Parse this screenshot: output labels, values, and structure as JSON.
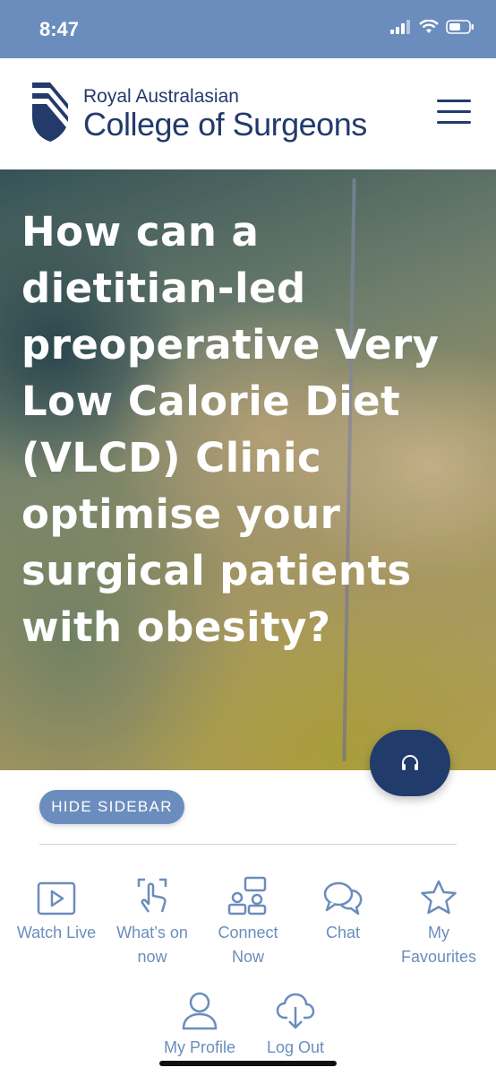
{
  "status_bar": {
    "time": "8:47"
  },
  "header": {
    "brand_line1": "Royal Australasian",
    "brand_line2": "College of Surgeons"
  },
  "hero": {
    "title": "How can a dietitian-led preoperative Very Low Calorie Diet (VLCD) Clinic optimise your surgical patients with obesity?"
  },
  "sidebar_toggle": {
    "label": "HIDE SIDEBAR"
  },
  "nav": {
    "watch_live": "Watch Live",
    "whats_on_1": "What’s on",
    "whats_on_2": "now",
    "connect_1": "Connect",
    "connect_2": "Now",
    "chat": "Chat",
    "fav_1": "My",
    "fav_2": "Favourites",
    "profile": "My Profile",
    "logout": "Log Out"
  },
  "colors": {
    "accent": "#6b8dbd",
    "brand_navy": "#233a6b"
  }
}
